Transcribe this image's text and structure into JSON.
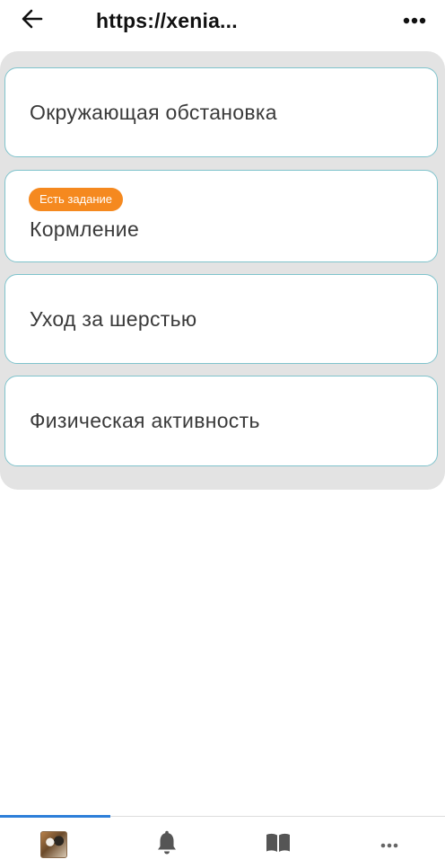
{
  "header": {
    "url": "https://xenia...",
    "back_icon": "arrow-left-icon",
    "more_icon": "more-horizontal-icon"
  },
  "cards": [
    {
      "label": "Окружающая обстановка",
      "badge": ""
    },
    {
      "label": "Кормление",
      "badge": "Есть задание"
    },
    {
      "label": "Уход за шерстью",
      "badge": ""
    },
    {
      "label": "Физическая активность",
      "badge": ""
    }
  ],
  "colors": {
    "badge": "#f5891f",
    "card_border": "#7fc3cc",
    "panel_bg": "#e3e3e3",
    "active_tab": "#2d7fd9"
  },
  "bottom_nav": {
    "items": [
      {
        "icon": "pet-avatar-icon",
        "active": true
      },
      {
        "icon": "bell-icon",
        "active": false
      },
      {
        "icon": "book-icon",
        "active": false
      },
      {
        "icon": "more-horizontal-icon",
        "active": false
      }
    ]
  }
}
